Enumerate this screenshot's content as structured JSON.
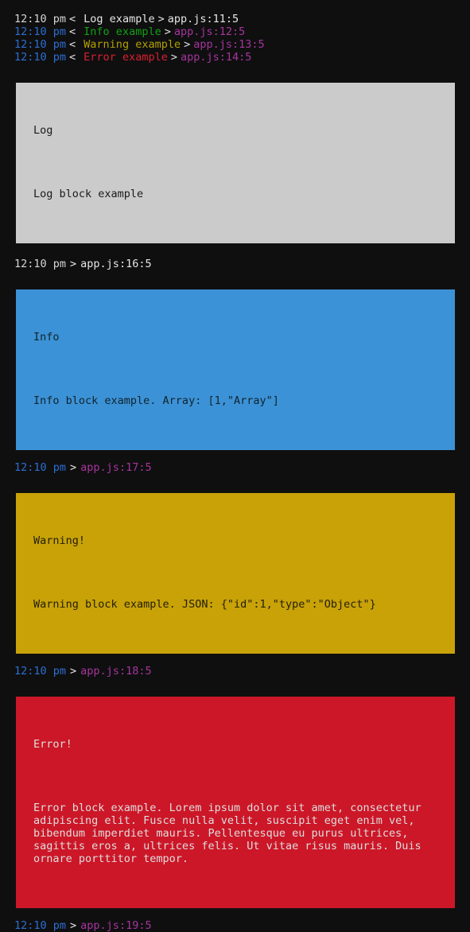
{
  "console": {
    "header_lines": [
      {
        "timestamp": "12:10 pm",
        "in_marker": "<",
        "message": "Log example",
        "out_marker": ">",
        "source": "app.js:11:5",
        "level": "log"
      },
      {
        "timestamp": "12:10 pm",
        "in_marker": "<",
        "message": "Info example",
        "out_marker": ">",
        "source": "app.js:12:5",
        "level": "info"
      },
      {
        "timestamp": "12:10 pm",
        "in_marker": "<",
        "message": "Warning example",
        "out_marker": ">",
        "source": "app.js:13:5",
        "level": "warning"
      },
      {
        "timestamp": "12:10 pm",
        "in_marker": "<",
        "message": "Error example",
        "out_marker": ">",
        "source": "app.js:14:5",
        "level": "error"
      }
    ],
    "groups": [
      {
        "level": "log",
        "title": "Log",
        "body": "Log block example",
        "trailer": {
          "timestamp": "12:10 pm",
          "out_marker": ">",
          "source": "app.js:16:5",
          "style": "plain"
        }
      },
      {
        "level": "info",
        "title": "Info",
        "body": "Info block example. Array: [1,\"Array\"]",
        "trailer": {
          "timestamp": "12:10 pm",
          "out_marker": ">",
          "source": "app.js:17:5",
          "style": "colored"
        }
      },
      {
        "level": "warning",
        "title": "Warning!",
        "body": "Warning block example. JSON: {\"id\":1,\"type\":\"Object\"}",
        "trailer": {
          "timestamp": "12:10 pm",
          "out_marker": ">",
          "source": "app.js:18:5",
          "style": "colored"
        }
      },
      {
        "level": "error",
        "title": "Error!",
        "body": "Error block example. Lorem ipsum dolor sit amet, consectetur adipiscing elit. Fusce nulla velit, suscipit eget enim vel, bibendum imperdiet mauris. Pellentesque eu purus ultrices, sagittis eros a, ultrices felis. Ut vitae risus mauris. Duis ornare porttitor tempor.",
        "trailer": {
          "timestamp": "12:10 pm",
          "out_marker": ">",
          "source": "app.js:19:5",
          "style": "colored"
        }
      }
    ]
  },
  "colors": {
    "background": "#0f0f10",
    "text_default": "#e6e6e6",
    "timestamp_blue": "#2c6fd1",
    "source_purple": "#a6359c",
    "level_info_text": "#12a012",
    "level_warning_text": "#b3a000",
    "level_error_text": "#d7202f",
    "block_log_bg": "#cbcbcb",
    "block_info_bg": "#3c92d6",
    "block_warning_bg": "#c8a207",
    "block_error_bg": "#cc1728"
  }
}
